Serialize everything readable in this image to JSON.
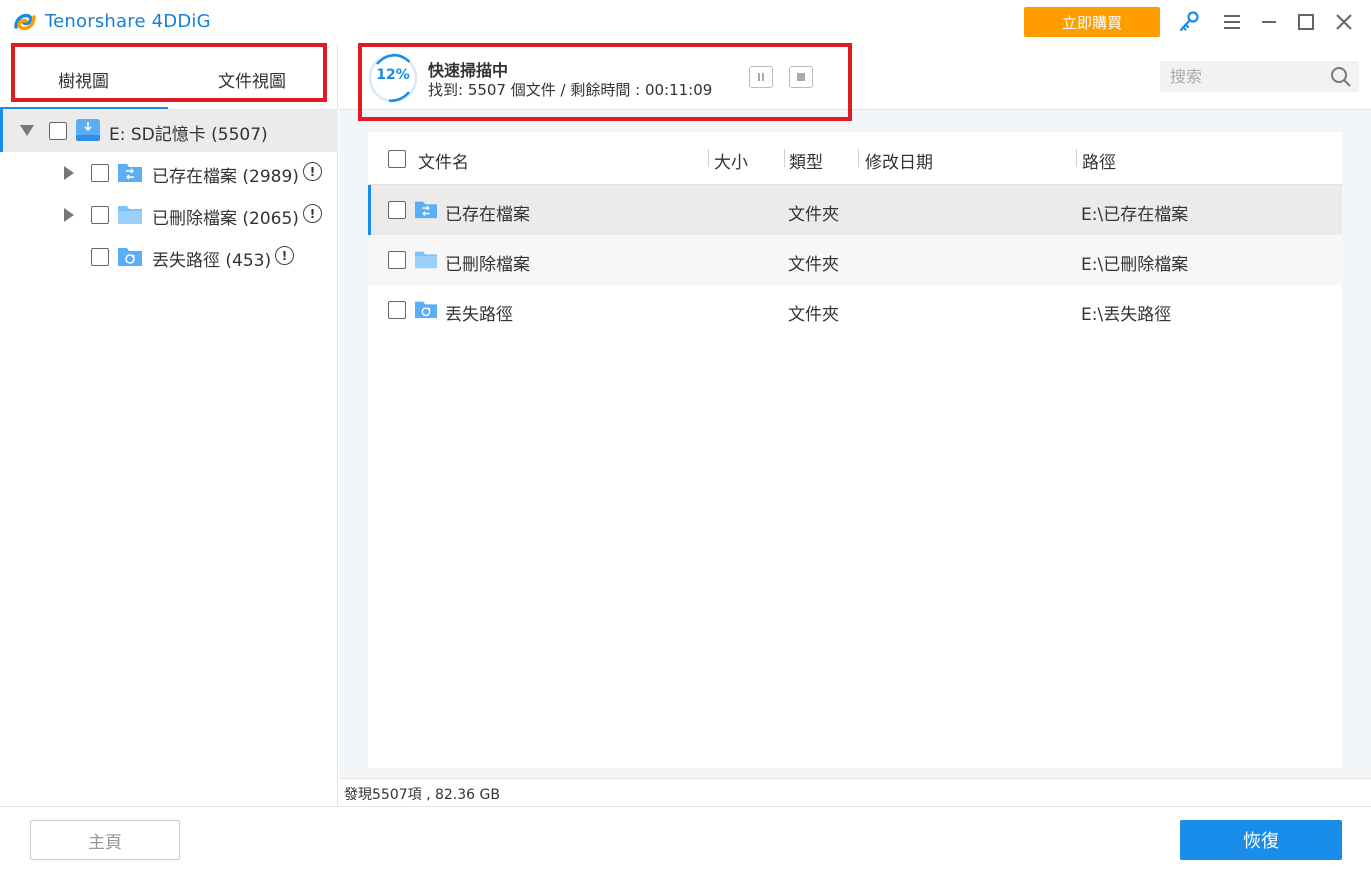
{
  "app": {
    "title": "Tenorshare 4DDiG",
    "buy_label": "立即購買"
  },
  "view_tabs": {
    "tree": "樹視圖",
    "file": "文件視圖"
  },
  "tree": {
    "root": "E: SD記憶卡 (5507)",
    "items": [
      {
        "label": "已存在檔案 (2989)",
        "icon": "existing-folder-icon",
        "expandable": true
      },
      {
        "label": "已刪除檔案 (2065)",
        "icon": "folder-icon",
        "expandable": true
      },
      {
        "label": "丟失路徑 (453)",
        "icon": "lost-folder-icon",
        "expandable": false
      }
    ]
  },
  "scan": {
    "progress": "12%",
    "progress_fraction": 0.12,
    "title": "快速掃描中",
    "found_text": "找到: 5507 個文件 /  剩餘時間 : 00:11:09"
  },
  "search": {
    "placeholder": "搜索"
  },
  "table": {
    "headers": {
      "name": "文件名",
      "size": "大小",
      "type": "類型",
      "modified": "修改日期",
      "path": "路徑"
    },
    "rows": [
      {
        "name": "已存在檔案",
        "icon": "existing-folder-icon",
        "size": "",
        "type": "文件夾",
        "modified": "",
        "path": "E:\\已存在檔案",
        "selected": true
      },
      {
        "name": "已刪除檔案",
        "icon": "folder-icon",
        "size": "",
        "type": "文件夾",
        "modified": "",
        "path": "E:\\已刪除檔案",
        "selected": false
      },
      {
        "name": "丟失路徑",
        "icon": "lost-folder-icon",
        "size": "",
        "type": "文件夾",
        "modified": "",
        "path": "E:\\丟失路徑",
        "selected": false
      }
    ]
  },
  "status": {
    "summary": "發現5507項 , 82.36 GB"
  },
  "footer": {
    "home_label": "主頁",
    "recover_label": "恢復"
  },
  "colors": {
    "accent": "#1a8ce9",
    "buy": "#ff9c00",
    "highlight_box": "#e11b22"
  }
}
